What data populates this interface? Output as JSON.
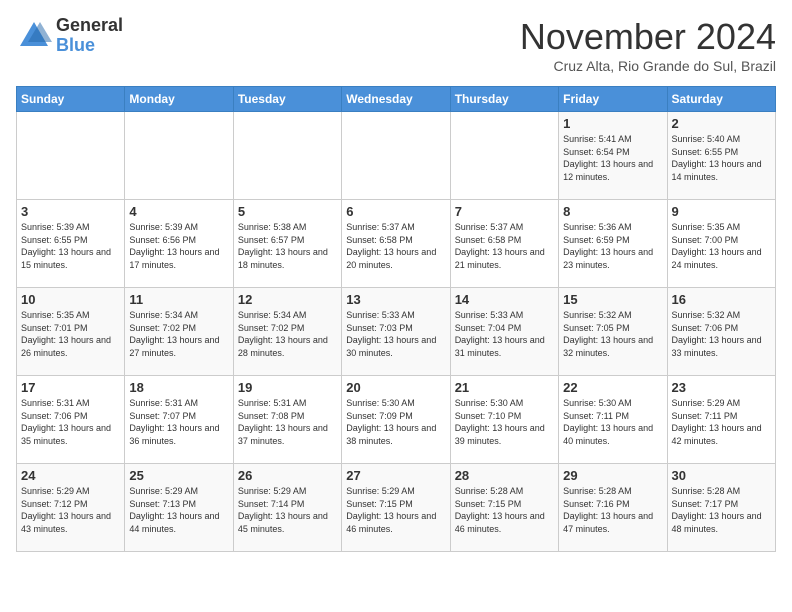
{
  "header": {
    "logo_general": "General",
    "logo_blue": "Blue",
    "month_title": "November 2024",
    "location": "Cruz Alta, Rio Grande do Sul, Brazil"
  },
  "days_of_week": [
    "Sunday",
    "Monday",
    "Tuesday",
    "Wednesday",
    "Thursday",
    "Friday",
    "Saturday"
  ],
  "weeks": [
    [
      {
        "day": "",
        "info": ""
      },
      {
        "day": "",
        "info": ""
      },
      {
        "day": "",
        "info": ""
      },
      {
        "day": "",
        "info": ""
      },
      {
        "day": "",
        "info": ""
      },
      {
        "day": "1",
        "info": "Sunrise: 5:41 AM\nSunset: 6:54 PM\nDaylight: 13 hours and 12 minutes."
      },
      {
        "day": "2",
        "info": "Sunrise: 5:40 AM\nSunset: 6:55 PM\nDaylight: 13 hours and 14 minutes."
      }
    ],
    [
      {
        "day": "3",
        "info": "Sunrise: 5:39 AM\nSunset: 6:55 PM\nDaylight: 13 hours and 15 minutes."
      },
      {
        "day": "4",
        "info": "Sunrise: 5:39 AM\nSunset: 6:56 PM\nDaylight: 13 hours and 17 minutes."
      },
      {
        "day": "5",
        "info": "Sunrise: 5:38 AM\nSunset: 6:57 PM\nDaylight: 13 hours and 18 minutes."
      },
      {
        "day": "6",
        "info": "Sunrise: 5:37 AM\nSunset: 6:58 PM\nDaylight: 13 hours and 20 minutes."
      },
      {
        "day": "7",
        "info": "Sunrise: 5:37 AM\nSunset: 6:58 PM\nDaylight: 13 hours and 21 minutes."
      },
      {
        "day": "8",
        "info": "Sunrise: 5:36 AM\nSunset: 6:59 PM\nDaylight: 13 hours and 23 minutes."
      },
      {
        "day": "9",
        "info": "Sunrise: 5:35 AM\nSunset: 7:00 PM\nDaylight: 13 hours and 24 minutes."
      }
    ],
    [
      {
        "day": "10",
        "info": "Sunrise: 5:35 AM\nSunset: 7:01 PM\nDaylight: 13 hours and 26 minutes."
      },
      {
        "day": "11",
        "info": "Sunrise: 5:34 AM\nSunset: 7:02 PM\nDaylight: 13 hours and 27 minutes."
      },
      {
        "day": "12",
        "info": "Sunrise: 5:34 AM\nSunset: 7:02 PM\nDaylight: 13 hours and 28 minutes."
      },
      {
        "day": "13",
        "info": "Sunrise: 5:33 AM\nSunset: 7:03 PM\nDaylight: 13 hours and 30 minutes."
      },
      {
        "day": "14",
        "info": "Sunrise: 5:33 AM\nSunset: 7:04 PM\nDaylight: 13 hours and 31 minutes."
      },
      {
        "day": "15",
        "info": "Sunrise: 5:32 AM\nSunset: 7:05 PM\nDaylight: 13 hours and 32 minutes."
      },
      {
        "day": "16",
        "info": "Sunrise: 5:32 AM\nSunset: 7:06 PM\nDaylight: 13 hours and 33 minutes."
      }
    ],
    [
      {
        "day": "17",
        "info": "Sunrise: 5:31 AM\nSunset: 7:06 PM\nDaylight: 13 hours and 35 minutes."
      },
      {
        "day": "18",
        "info": "Sunrise: 5:31 AM\nSunset: 7:07 PM\nDaylight: 13 hours and 36 minutes."
      },
      {
        "day": "19",
        "info": "Sunrise: 5:31 AM\nSunset: 7:08 PM\nDaylight: 13 hours and 37 minutes."
      },
      {
        "day": "20",
        "info": "Sunrise: 5:30 AM\nSunset: 7:09 PM\nDaylight: 13 hours and 38 minutes."
      },
      {
        "day": "21",
        "info": "Sunrise: 5:30 AM\nSunset: 7:10 PM\nDaylight: 13 hours and 39 minutes."
      },
      {
        "day": "22",
        "info": "Sunrise: 5:30 AM\nSunset: 7:11 PM\nDaylight: 13 hours and 40 minutes."
      },
      {
        "day": "23",
        "info": "Sunrise: 5:29 AM\nSunset: 7:11 PM\nDaylight: 13 hours and 42 minutes."
      }
    ],
    [
      {
        "day": "24",
        "info": "Sunrise: 5:29 AM\nSunset: 7:12 PM\nDaylight: 13 hours and 43 minutes."
      },
      {
        "day": "25",
        "info": "Sunrise: 5:29 AM\nSunset: 7:13 PM\nDaylight: 13 hours and 44 minutes."
      },
      {
        "day": "26",
        "info": "Sunrise: 5:29 AM\nSunset: 7:14 PM\nDaylight: 13 hours and 45 minutes."
      },
      {
        "day": "27",
        "info": "Sunrise: 5:29 AM\nSunset: 7:15 PM\nDaylight: 13 hours and 46 minutes."
      },
      {
        "day": "28",
        "info": "Sunrise: 5:28 AM\nSunset: 7:15 PM\nDaylight: 13 hours and 46 minutes."
      },
      {
        "day": "29",
        "info": "Sunrise: 5:28 AM\nSunset: 7:16 PM\nDaylight: 13 hours and 47 minutes."
      },
      {
        "day": "30",
        "info": "Sunrise: 5:28 AM\nSunset: 7:17 PM\nDaylight: 13 hours and 48 minutes."
      }
    ]
  ]
}
